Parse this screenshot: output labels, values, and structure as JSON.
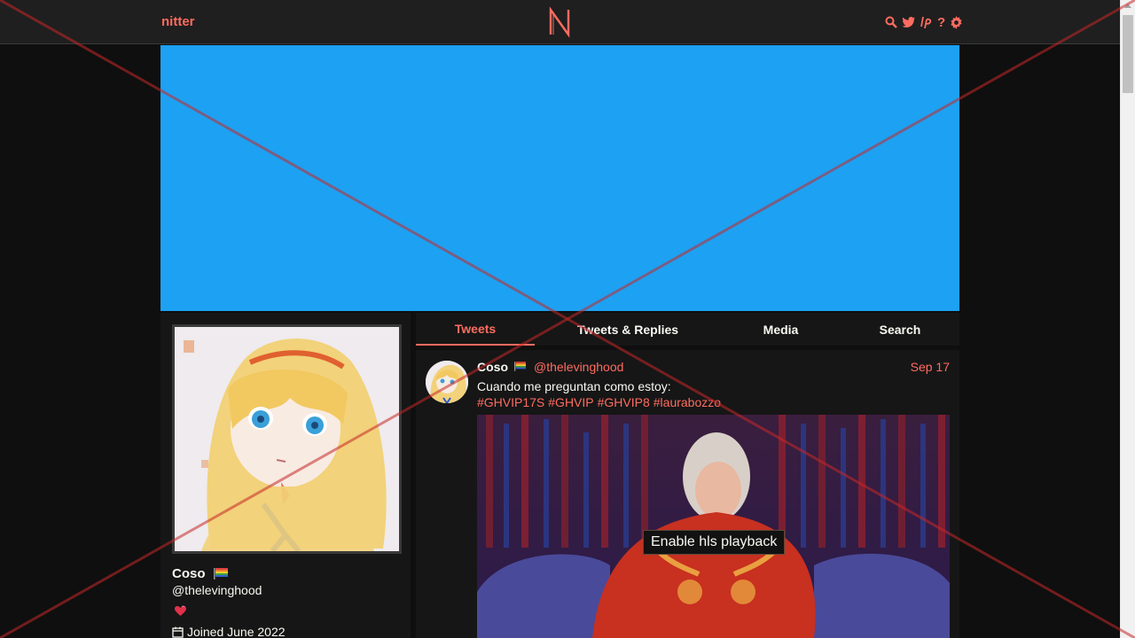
{
  "navbar": {
    "brand": "nitter",
    "logo_letter": "N",
    "icons": [
      "search-icon",
      "bird-icon",
      "lp-icon",
      "help-icon",
      "gear-icon"
    ]
  },
  "profile": {
    "name": "Coso",
    "handle": "@thelevinghood",
    "joined": "Joined June 2022"
  },
  "tabs": [
    {
      "label": "Tweets",
      "active": true
    },
    {
      "label": "Tweets & Replies",
      "active": false
    },
    {
      "label": "Media",
      "active": false
    },
    {
      "label": "Search",
      "active": false
    }
  ],
  "tweet": {
    "name": "Coso",
    "handle": "@thelevinghood",
    "date": "Sep 17",
    "text": "Cuando me preguntan como estoy:",
    "hashtags": [
      "#GHVIP17S",
      "#GHVIP",
      "#GHVIP8",
      "#laurabozzo"
    ],
    "hls_button": "Enable hls playback"
  },
  "colors": {
    "accent": "#ff6c60",
    "banner": "#1da1f2",
    "background": "#0f0f0f",
    "panel": "#161616"
  }
}
